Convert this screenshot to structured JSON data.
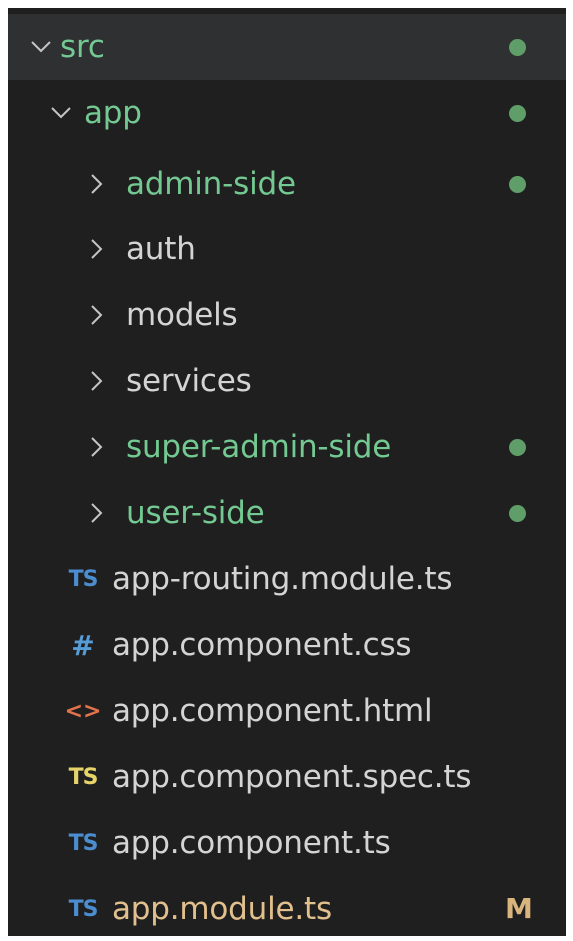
{
  "tree": {
    "src": {
      "label": "src",
      "status": "untracked"
    },
    "app": {
      "label": "app",
      "status": "untracked"
    },
    "folders": [
      {
        "label": "admin-side",
        "color": "green",
        "dot": true
      },
      {
        "label": "auth",
        "color": "white",
        "dot": false
      },
      {
        "label": "models",
        "color": "white",
        "dot": false
      },
      {
        "label": "services",
        "color": "white",
        "dot": false
      },
      {
        "label": "super-admin-side",
        "color": "green",
        "dot": true
      },
      {
        "label": "user-side",
        "color": "green",
        "dot": true
      }
    ],
    "files": [
      {
        "label": "app-routing.module.ts",
        "icon": "TS",
        "icon_name": "typescript-icon"
      },
      {
        "label": "app.component.css",
        "icon": "#",
        "icon_name": "css-icon"
      },
      {
        "label": "app.component.html",
        "icon": "<>",
        "icon_name": "html-icon"
      },
      {
        "label": "app.component.spec.ts",
        "icon": "TS",
        "icon_name": "typescript-test-icon"
      },
      {
        "label": "app.component.ts",
        "icon": "TS",
        "icon_name": "typescript-icon"
      },
      {
        "label": "app.module.ts",
        "icon": "TS",
        "icon_name": "typescript-icon",
        "badge": "M"
      }
    ]
  },
  "colors": {
    "background": "#1f1f1f",
    "selected_row": "#2f3032",
    "untracked_green": "#73c991",
    "modified_yellow": "#e2c08d",
    "default_text": "#d4d4d4",
    "status_dot": "#5f9e68"
  }
}
